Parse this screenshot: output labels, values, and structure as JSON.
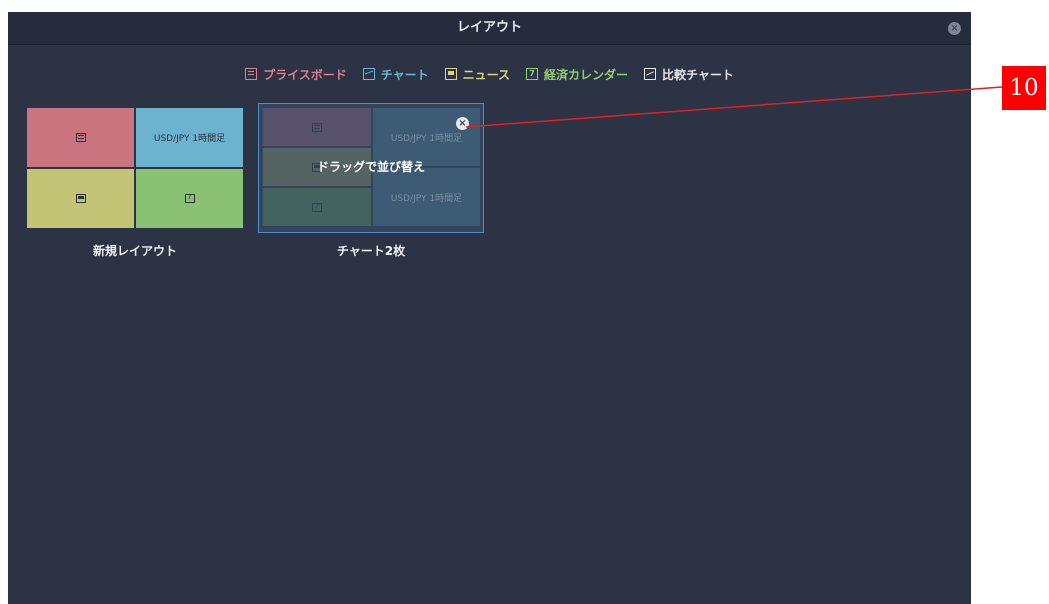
{
  "window": {
    "title": "レイアウト",
    "close_glyph": "×"
  },
  "legend": [
    {
      "label": "プライスボード",
      "icon": "price-board-icon",
      "color": "#e07e8e"
    },
    {
      "label": "チャート",
      "icon": "chart-icon",
      "color": "#69b7d4"
    },
    {
      "label": "ニュース",
      "icon": "news-icon",
      "color": "#d8d57a"
    },
    {
      "label": "経済カレンダー",
      "icon": "calendar-icon",
      "color": "#8fcf6f"
    },
    {
      "label": "比較チャート",
      "icon": "compare-chart-icon",
      "color": "#e6e6e6"
    }
  ],
  "layouts": [
    {
      "name": "新規レイアウト",
      "tiles": [
        {
          "kind": "price-board",
          "label": "",
          "color": "#c9747f"
        },
        {
          "kind": "chart",
          "label": "USD/JPY 1時間足",
          "color": "#6bb3cf"
        },
        {
          "kind": "news",
          "label": "",
          "color": "#c4c477"
        },
        {
          "kind": "calendar",
          "label": "",
          "color": "#8bc173"
        }
      ]
    },
    {
      "name": "チャート2枚",
      "drag_label": "ドラッグで並び替え",
      "remove_glyph": "×",
      "tiles": [
        {
          "kind": "price-board",
          "label": "",
          "color": "#6e4c5d"
        },
        {
          "kind": "chart",
          "label": "USD/JPY 1時間足",
          "color": "#3f5b72"
        },
        {
          "kind": "news",
          "label": "",
          "color": "#6a6a50"
        },
        {
          "kind": "chart",
          "label": "USD/JPY 1時間足",
          "color": "#3f5b72"
        },
        {
          "kind": "calendar",
          "label": "",
          "color": "#4c6a4c"
        }
      ]
    }
  ],
  "callout": {
    "label": "10",
    "color": "#ff0000"
  }
}
